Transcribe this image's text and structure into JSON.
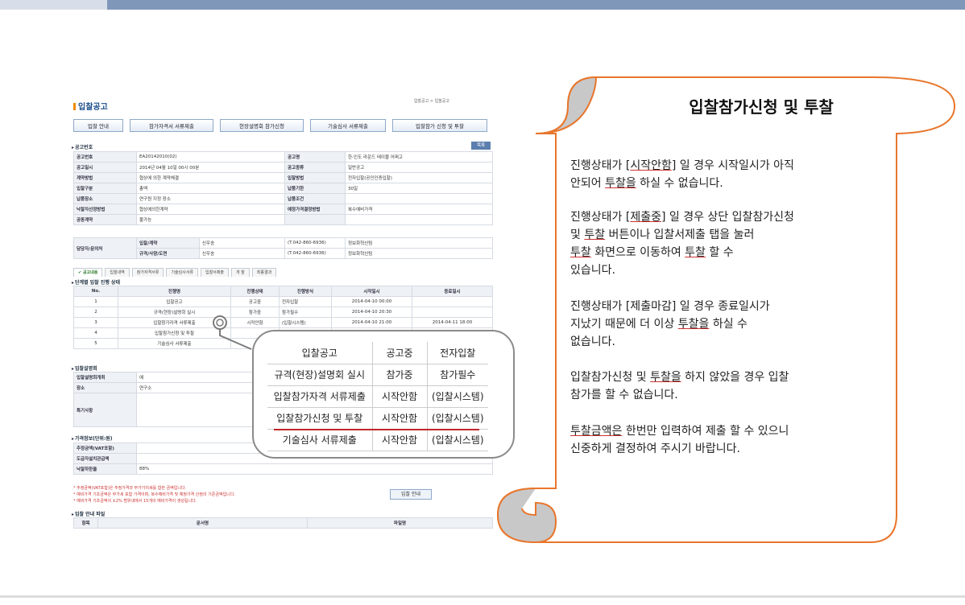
{
  "title": "입찰참가신청 및 투찰",
  "screen": {
    "page_title": "입찰공고",
    "breadcrumb": "입찰공고 > 입찰공고",
    "tabs": [
      "입찰 안내",
      "참가자격서 서류제출",
      "현장설명회 참가신청",
      "기술심사 서류제출",
      "입찰참가 신청 및 투찰"
    ],
    "section1": "공고번호",
    "list_btn": "목록",
    "info": [
      [
        "공고번호",
        "EA20142010(02)",
        "공고명",
        "한-인도 라운드 테이블 어쩌고"
      ],
      [
        "공고일시",
        "2014년 04월 10일 00시 00분",
        "공고종류",
        "일반공고"
      ],
      [
        "계약방법",
        "협상에 의한 계약체결",
        "입찰방법",
        "전자입찰(공인인증입찰)"
      ],
      [
        "입찰구분",
        "총액",
        "납품기한",
        "30일"
      ],
      [
        "납품장소",
        "연구원 지정 장소",
        "납품조건",
        ""
      ],
      [
        "낙찰자선정방법",
        "협상에의한계약",
        "예정가격결정방법",
        "복수예비가격"
      ],
      [
        "공동계약",
        "불가능",
        "",
        ""
      ]
    ],
    "contact": {
      "label": "담당자/문의처",
      "rows": [
        [
          "입찰/계약",
          "신우송",
          "(T.042-860-6936)",
          "정보화혁신팀"
        ],
        [
          "규격/사양/도면",
          "신우송",
          "(T.042-860-6936)",
          "정보화혁신팀"
        ]
      ]
    },
    "subtabs": [
      "공고내용",
      "입찰내역",
      "참가자격서류",
      "기술심사서류",
      "입찰서제출",
      "개 찰",
      "최종결과"
    ],
    "section2": "단계별 입찰 진행 상태",
    "status_headers": [
      "No.",
      "진행명",
      "진행상태",
      "진행방식",
      "시작일시",
      "종료일시"
    ],
    "status_rows": [
      [
        "1",
        "입찰공고",
        "공고중",
        "전자입찰",
        "2014-04-10 00:00",
        ""
      ],
      [
        "2",
        "규격(현장)설명회 실시",
        "참가중",
        "참가필수",
        "2014-04-10 20:30",
        ""
      ],
      [
        "3",
        "입찰참가자격 서류제출",
        "시작안함",
        "(입찰시스템)",
        "2014-04-10 21:00",
        "2014-04-11 18:00"
      ],
      [
        "4",
        "입찰참가신청 및 투찰",
        "",
        "",
        "",
        ""
      ],
      [
        "5",
        "기술심사 서류제출",
        "",
        "",
        "",
        ""
      ]
    ],
    "section3": "입찰설명회",
    "briefing": [
      [
        "입찰설명회개최",
        "예"
      ],
      [
        "장소",
        "연구소"
      ],
      [
        "특기사항",
        ""
      ]
    ],
    "section4": "가격정보(단위:원)",
    "price": [
      [
        "추정금액(VAT포함)",
        "2"
      ],
      [
        "도급자설치관급액",
        ""
      ],
      [
        "낙찰하한율",
        "88%"
      ]
    ],
    "notes": [
      "* 추정금액(VAT포함)은 추정가격과 부가가치세를 합한 금액입니다.",
      "* 예비가격 기초금액은 부가세 포함 가격이며, 복수예비가격 및 예정가격 산정의 기준금액입니다.",
      "* 예비가격 기초금액의 ±2% 범위내에서 15개의 예비가격이 생성됩니다."
    ],
    "guide_btn": "입찰 안내",
    "section5": "입찰 안내 파일",
    "file_headers": [
      "항목",
      "문서명",
      "파일명"
    ]
  },
  "callout_rows": [
    [
      "입찰공고",
      "공고중",
      "전자입찰"
    ],
    [
      "규격(현장)설명회 실시",
      "참가중",
      "참가필수"
    ],
    [
      "입찰참가자격 서류제출",
      "시작안함",
      "(입찰시스템)"
    ],
    [
      "입찰참가신청 및 투찰",
      "시작안함",
      "(입찰시스템)"
    ],
    [
      "기술심사 서류제출",
      "시작안함",
      "(입찰시스템)"
    ]
  ],
  "paragraphs": {
    "p1a": "진행상태가 [",
    "p1u": "시작안함",
    "p1b": "] 일 경우 시작일시가 아직",
    "p1c": " 안되어 ",
    "p1u2": "투찰을",
    "p1d": " 하실 수 없습니다.",
    "p2a": "진행상태가 [",
    "p2u": "제출중",
    "p2b": "] 일 경우 상단 입찰참가신청",
    "p2c": "및 ",
    "p2u2": "투찰",
    "p2d": " 버튼이나 입찰서제출 탭을 눌러",
    "p2u3": "투찰",
    "p2e": " 화면으로 이동하여 ",
    "p2u4": "투찰",
    "p2f": " 할 수",
    "p2g": "있습니다.",
    "p3a": "진행상태가 [제출마감] 일 경우 종료일시가",
    "p3b": "지났기 때문에 더 이상 ",
    "p3u": "투찰을",
    "p3c": " 하실 수",
    "p3d": "없습니다.",
    "p4a": "입찰참가신청 및 ",
    "p4u": "투찰을",
    "p4b": " 하지 않았을 경우 입찰",
    "p4c": "참가를 할 수 없습니다.",
    "p5u": "투찰금액은",
    "p5a": " 한번만 입력하여 제출 할 수 있으니",
    "p5b": "신중하게 결정하여 주시기 바랍니다."
  },
  "colors": {
    "accent": "#f08a00",
    "scroll": "#e8762c",
    "curl": "#c8c8c8"
  }
}
